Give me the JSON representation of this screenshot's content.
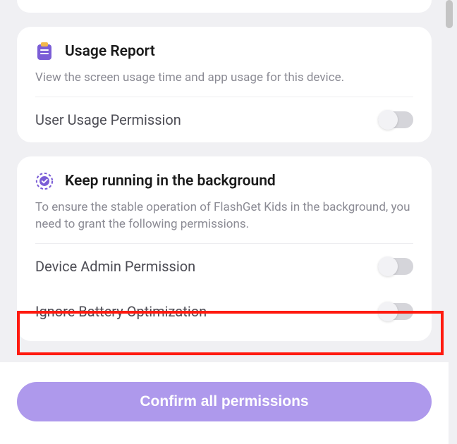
{
  "sections": {
    "usage": {
      "title": "Usage Report",
      "desc": "View the screen usage time and app usage for this device.",
      "items": {
        "user_usage_permission": {
          "label": "User Usage Permission",
          "enabled": false
        }
      }
    },
    "background": {
      "title": "Keep running in the background",
      "desc": "To ensure the stable operation of FlashGet Kids in the background, you need to grant the following permissions.",
      "items": {
        "device_admin": {
          "label": "Device Admin Permission",
          "enabled": false
        },
        "ignore_battery": {
          "label": "Ignore Battery Optimization",
          "enabled": false
        }
      }
    }
  },
  "footer": {
    "confirm_label": "Confirm all permissions"
  },
  "colors": {
    "accent": "#7b5dd6",
    "highlight": "#ff1a0f",
    "button": "#ae99ec"
  }
}
